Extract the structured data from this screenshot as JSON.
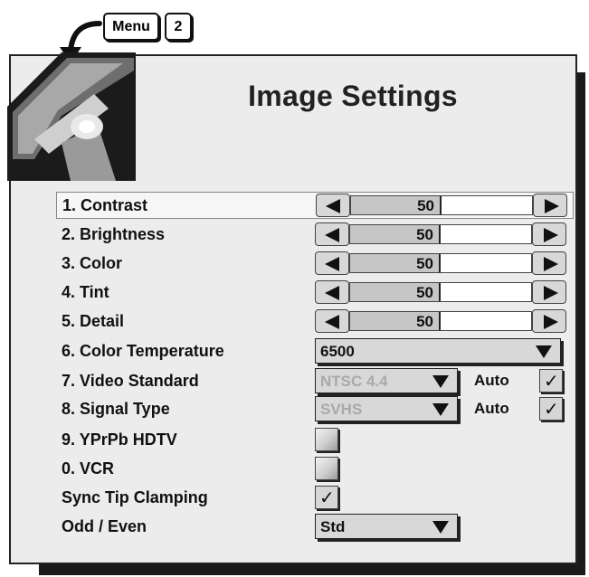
{
  "menu_hint": {
    "menu_key": "Menu",
    "number_key": "2"
  },
  "title": "Image Settings",
  "sliders": [
    {
      "label": "1. Contrast",
      "value": "50",
      "level": 0.5
    },
    {
      "label": "2. Brightness",
      "value": "50",
      "level": 0.5
    },
    {
      "label": "3. Color",
      "value": "50",
      "level": 0.5
    },
    {
      "label": "4. Tint",
      "value": "50",
      "level": 0.5
    },
    {
      "label": "5. Detail",
      "value": "50",
      "level": 0.5
    }
  ],
  "color_temperature": {
    "label": "6. Color Temperature",
    "value": "6500"
  },
  "video_standard": {
    "label": "7. Video Standard",
    "value": "NTSC 4.4",
    "auto_label": "Auto",
    "auto_checked": true,
    "enabled": false
  },
  "signal_type": {
    "label": "8. Signal Type",
    "value": "SVHS",
    "auto_label": "Auto",
    "auto_checked": true,
    "enabled": false
  },
  "ypprb_hdtv": {
    "label": "9. YPrPb HDTV",
    "checked": false
  },
  "vcr": {
    "label": "0. VCR",
    "checked": false
  },
  "sync_tip_clamping": {
    "label": "Sync Tip Clamping",
    "checked": true
  },
  "odd_even": {
    "label": "Odd / Even",
    "value": "Std"
  },
  "checkmark": "✓",
  "colors": {
    "panel_bg": "#ececec",
    "control_bg": "#d8d8d8",
    "disabled_text": "#a9a9a9"
  }
}
